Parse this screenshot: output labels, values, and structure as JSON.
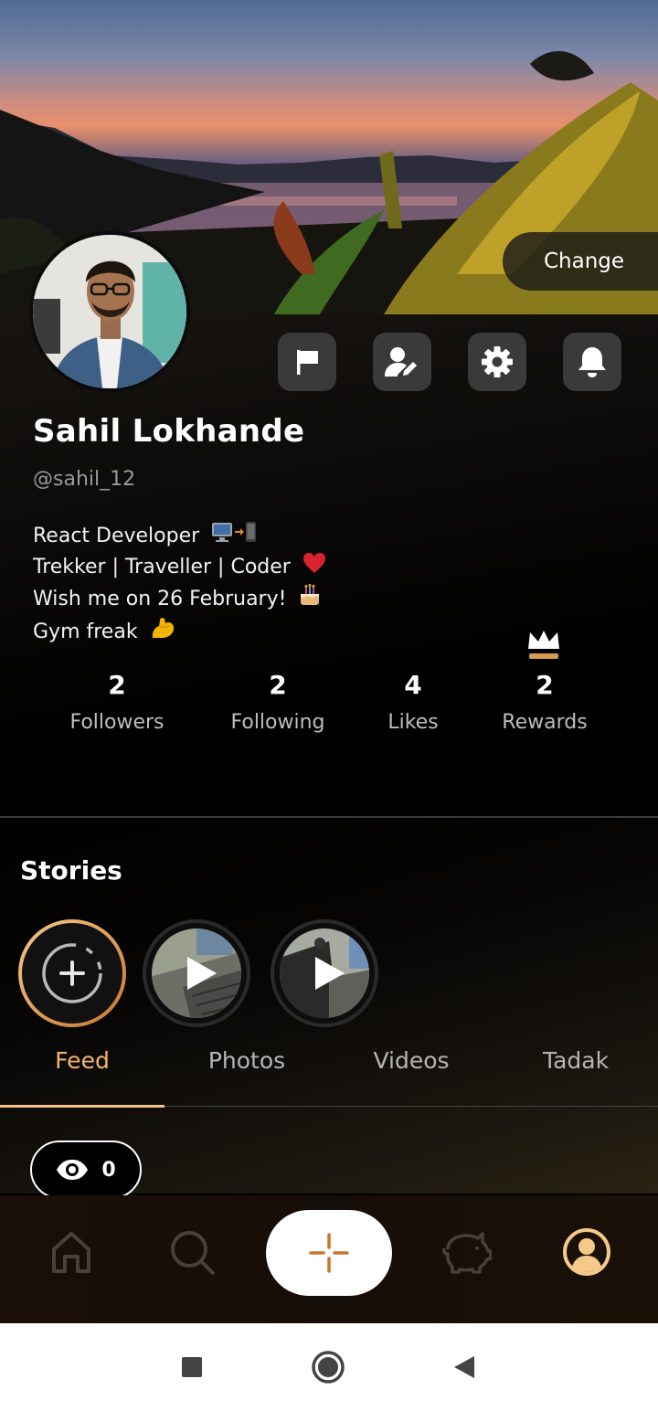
{
  "cover": {
    "change_label": "Change"
  },
  "profile": {
    "name": "Sahil Lokhande",
    "handle": "@sahil_12",
    "bio": [
      "React Developer",
      "Trekker | Traveller | Coder",
      "Wish me on 26 February!",
      "Gym freak"
    ],
    "actions": [
      "flag-icon",
      "edit-profile-icon",
      "settings-icon",
      "bell-icon"
    ]
  },
  "stats": [
    {
      "value": "2",
      "label": "Followers"
    },
    {
      "value": "2",
      "label": "Following"
    },
    {
      "value": "4",
      "label": "Likes"
    },
    {
      "value": "2",
      "label": "Rewards"
    }
  ],
  "stories": {
    "title": "Stories",
    "items": [
      "add-story",
      "story-video-1",
      "story-video-2"
    ]
  },
  "tabs": [
    "Feed",
    "Photos",
    "Videos",
    "Tadak"
  ],
  "active_tab": "Feed",
  "views": {
    "count": "0"
  },
  "bottom_nav": [
    "home-icon",
    "search-icon",
    "create-icon",
    "piggy-bank-icon",
    "profile-icon"
  ],
  "colors": {
    "accent": "#f2b56b",
    "accent_dark": "#c9762a",
    "nav_active": "#f5c98a"
  }
}
